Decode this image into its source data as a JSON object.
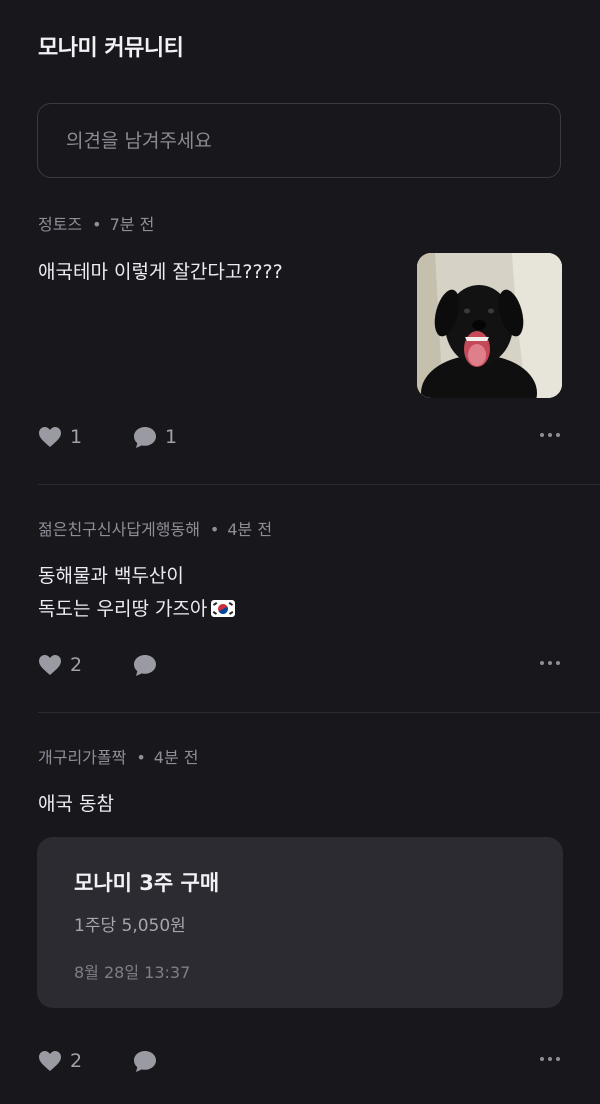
{
  "header": {
    "title": "모나미 커뮤니티"
  },
  "comment_input": {
    "placeholder": "의견을 남겨주세요"
  },
  "posts": [
    {
      "author": "정토즈",
      "time": "7분 전",
      "lines": [
        "애국테마 이렇게 잘간다고????"
      ],
      "image": "black-dog-photo",
      "likes": "1",
      "comments": "1"
    },
    {
      "author": "젊은친구신사답게행동해",
      "time": "4분 전",
      "lines": [
        "동해물과 백두산이",
        "독도는 우리땅 가즈아"
      ],
      "emoji": "korea-flag",
      "likes": "2",
      "comments": ""
    },
    {
      "author": "개구리가폴짝",
      "time": "4분 전",
      "lines": [
        "애국 동참"
      ],
      "trade": {
        "title": "모나미 3주 구매",
        "price": "1주당 5,050원",
        "date": "8월 28일 13:37"
      },
      "likes": "2",
      "comments": ""
    }
  ],
  "meta_separator": "•",
  "icons": {
    "like": "heart-icon",
    "comment": "speech-bubble-icon",
    "more": "more-horizontal-icon"
  },
  "colors": {
    "background": "#17171c",
    "card": "#2b2b31",
    "icon": "#a2a2aa"
  }
}
